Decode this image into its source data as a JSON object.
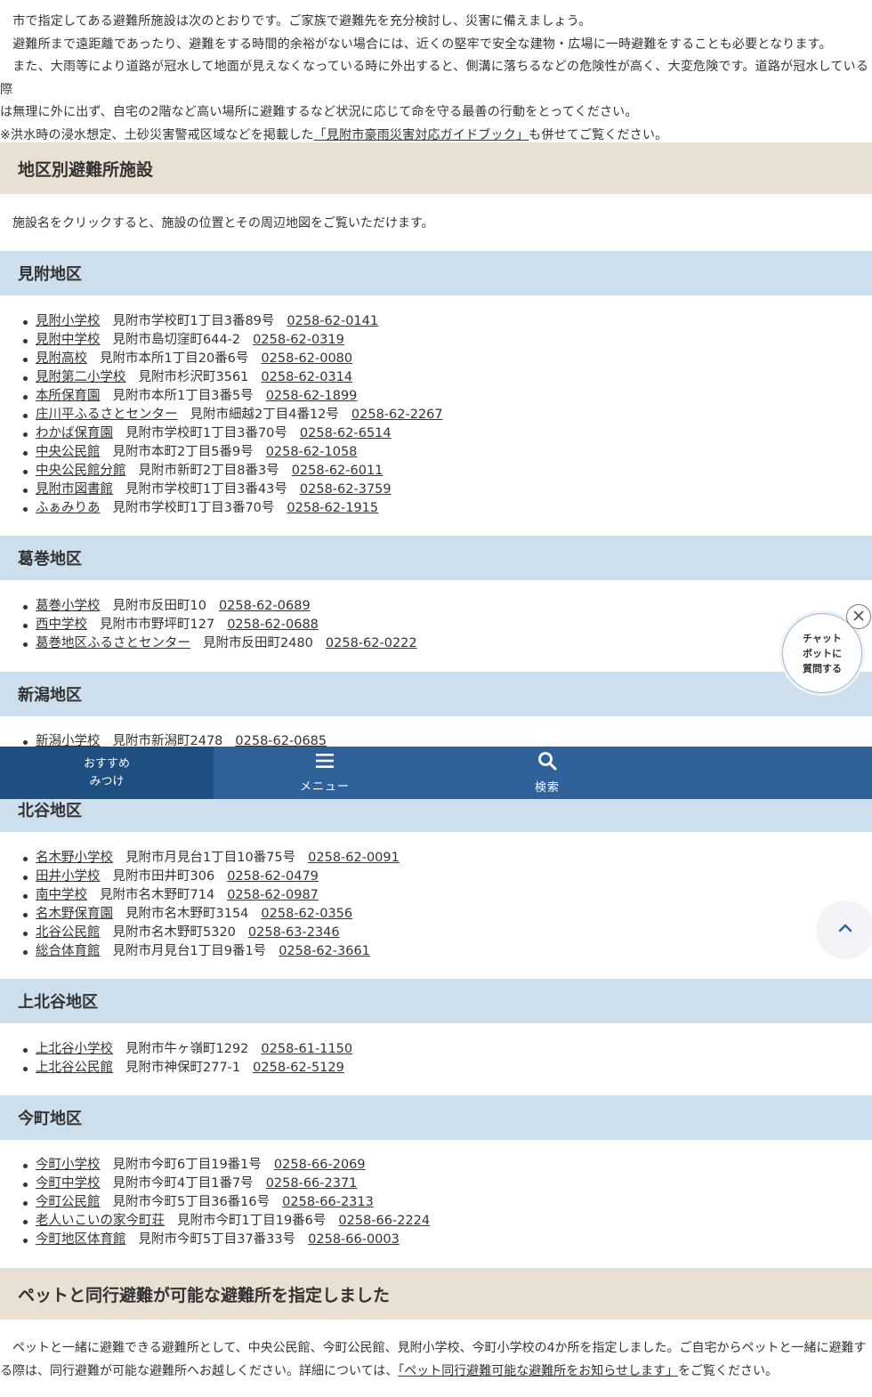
{
  "intro": {
    "line1": "　市で指定してある避難所施設は次のとおりです。ご家族で避難先を充分検討し、災害に備えましょう。",
    "line2": "　避難所まで遠距離であったり、避難をする時間的余裕がない場合には、近くの堅牢で安全な建物・広場に一時避難をすることも必要となります。",
    "line3": "　また、大雨等により道路が冠水して地面が見えなくなっている時に外出すると、側溝に落ちるなどの危険性が高く、大変危険です。道路が冠水している際",
    "line4": "は無理に外に出ず、自宅の2階など高い場所に避難するなど状況に応じて命を守る最善の行動をとってください。",
    "line5_pre": "※洪水時の浸水想定、土砂災害警戒区域などを掲載した",
    "line5_link": "「見附市豪雨災害対応ガイドブック」",
    "line5_post": "も併せてご覧ください。"
  },
  "section_shelters": {
    "title": "地区別避難所施設",
    "note": "施設名をクリックすると、施設の位置とその周辺地図をご覧いただけます。"
  },
  "districts": [
    {
      "title": "見附地区",
      "items": [
        {
          "name": "見附小学校",
          "address": "見附市学校町1丁目3番89号",
          "tel": "0258-62-0141"
        },
        {
          "name": "見附中学校",
          "address": "見附市島切窪町644-2",
          "tel": "0258-62-0319"
        },
        {
          "name": "見附高校",
          "address": "見附市本所1丁目20番6号",
          "tel": "0258-62-0080"
        },
        {
          "name": "見附第二小学校",
          "address": "見附市杉沢町3561",
          "tel": "0258-62-0314"
        },
        {
          "name": "本所保育園",
          "address": "見附市本所1丁目3番5号",
          "tel": "0258-62-1899"
        },
        {
          "name": "庄川平ふるさとセンター",
          "address": "見附市細越2丁目4番12号",
          "tel": "0258-62-2267"
        },
        {
          "name": "わかば保育園",
          "address": "見附市学校町1丁目3番70号",
          "tel": "0258-62-6514"
        },
        {
          "name": "中央公民館",
          "address": "見附市本町2丁目5番9号",
          "tel": "0258-62-1058"
        },
        {
          "name": "中央公民館分館",
          "address": "見附市新町2丁目8番3号",
          "tel": "0258-62-6011"
        },
        {
          "name": "見附市図書館",
          "address": "見附市学校町1丁目3番43号",
          "tel": "0258-62-3759"
        },
        {
          "name": "ふぁみりあ",
          "address": "見附市学校町1丁目3番70号",
          "tel": "0258-62-1915"
        }
      ]
    },
    {
      "title": "葛巻地区",
      "items": [
        {
          "name": "葛巻小学校",
          "address": "見附市反田町10",
          "tel": "0258-62-0689"
        },
        {
          "name": "西中学校",
          "address": "見附市市野坪町127",
          "tel": "0258-62-0688"
        },
        {
          "name": "葛巻地区ふるさとセンター",
          "address": "見附市反田町2480",
          "tel": "0258-62-0222"
        }
      ]
    },
    {
      "title": "新潟地区",
      "items": [
        {
          "name": "新潟小学校",
          "address": "見附市新潟町2478",
          "tel": "0258-62-0685"
        }
      ]
    },
    {
      "title": "北谷地区",
      "items": [
        {
          "name": "名木野小学校",
          "address": "見附市月見台1丁目10番75号",
          "tel": "0258-62-0091"
        },
        {
          "name": "田井小学校",
          "address": "見附市田井町306",
          "tel": "0258-62-0479"
        },
        {
          "name": "南中学校",
          "address": "見附市名木野町714",
          "tel": "0258-62-0987"
        },
        {
          "name": "名木野保育園",
          "address": "見附市名木野町3154",
          "tel": "0258-62-0356"
        },
        {
          "name": "北谷公民館",
          "address": "見附市名木野町5320",
          "tel": "0258-63-2346"
        },
        {
          "name": "総合体育館",
          "address": "見附市月見台1丁目9番1号",
          "tel": "0258-62-3661"
        }
      ]
    },
    {
      "title": "上北谷地区",
      "items": [
        {
          "name": "上北谷小学校",
          "address": "見附市牛ヶ嶺町1292",
          "tel": "0258-61-1150"
        },
        {
          "name": "上北谷公民館",
          "address": "見附市神保町277-1",
          "tel": "0258-62-5129"
        }
      ]
    },
    {
      "title": "今町地区",
      "items": [
        {
          "name": "今町小学校",
          "address": "見附市今町6丁目19番1号",
          "tel": "0258-66-2069"
        },
        {
          "name": "今町中学校",
          "address": "見附市今町4丁目1番7号",
          "tel": "0258-66-2371"
        },
        {
          "name": "今町公民館",
          "address": "見附市今町5丁目36番16号",
          "tel": "0258-66-2313"
        },
        {
          "name": "老人いこいの家今町荘",
          "address": "見附市今町1丁目19番6号",
          "tel": "0258-66-2224"
        },
        {
          "name": "今町地区体育館",
          "address": "見附市今町5丁目37番33号",
          "tel": "0258-66-0003"
        }
      ]
    }
  ],
  "section_pets": {
    "title": "ペットと同行避難が可能な避難所を指定しました",
    "line1": "　ペットと一緒に避難できる避難所として、中央公民館、今町公民館、見附小学校、今町小学校の4か所を指定しました。ご自宅からペットと一緒に避難す",
    "line2_pre": "る際は、同行避難が可能な避難所へお越しください。詳細については、",
    "line2_link": "「ペット同行避難可能な避難所をお知らせします」",
    "line2_post": "をご覧ください。"
  },
  "navbar": {
    "recommend_line1": "おすすめ",
    "recommend_line2": "みつけ",
    "menu_label": "メニュー",
    "search_label": "検索",
    "menu_icon": "hamburger-icon",
    "search_icon": "search-icon"
  },
  "chat": {
    "line1": "チャット",
    "line2": "ボットに",
    "line3": "質問する"
  },
  "colors": {
    "section_header_bg": "#e8e0d3",
    "district_header_bg": "#cddeec",
    "navbar_bg": "#2f619a",
    "navbar_recommend_bg": "#1f4e80"
  }
}
